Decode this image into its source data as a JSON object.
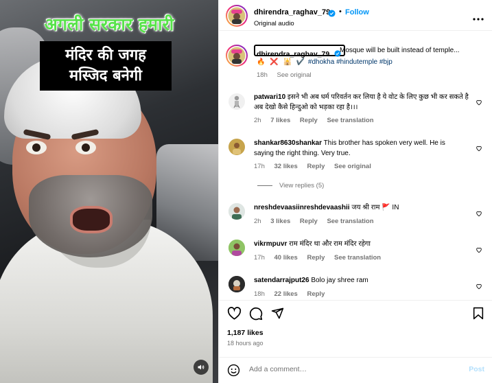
{
  "media": {
    "overlay_top": "अगली सरकार हमारी",
    "overlay_line1": "मंदिर की जगह",
    "overlay_line2": "मस्जिद बनेगी",
    "sound_icon": "speaker-icon"
  },
  "header": {
    "username": "dhirendra_raghav_79",
    "separator": "•",
    "follow_label": "Follow",
    "audio": "Original audio"
  },
  "caption": {
    "username": "dhirendra_raghav_79",
    "text": "Mosque will be built instead of temple...",
    "emojis": "🔥 ❌ 🕌 ✔️",
    "hashtags": "#dhokha #hindutemple #bjp",
    "time": "18h",
    "see_original": "See original"
  },
  "comments": [
    {
      "user": "patwari10",
      "text": "इसने भी अब धर्म परिवर्तन कर लिया है ये वोट के लिए कुछ भी कर सकते है अब देखो कैसे हिन्दुओ को भड़का रहा है।।।",
      "time": "2h",
      "likes": "7 likes",
      "reply": "Reply",
      "action": "See translation"
    },
    {
      "user": "shankar8630shankar",
      "text": "This brother has spoken very well. He is saying the right thing. Very true.",
      "time": "17h",
      "likes": "32 likes",
      "reply": "Reply",
      "action": "See original"
    },
    {
      "user": "nreshdevaasiinreshdevaashii",
      "text": "जय श्री राम 🚩 IN",
      "time": "2h",
      "likes": "3 likes",
      "reply": "Reply",
      "action": "See translation"
    },
    {
      "user": "vikrmpuvr",
      "text": "राम मंदिर था और राम मंदिर रहेगा",
      "time": "17h",
      "likes": "40 likes",
      "reply": "Reply",
      "action": "See translation"
    },
    {
      "user": "satendarrajput26",
      "text": "Bolo jay shree ram",
      "time": "18h",
      "likes": "22 likes",
      "reply": "Reply",
      "action": ""
    }
  ],
  "view_replies": "View replies (5)",
  "stats": {
    "likes": "1,187 likes",
    "ago": "18 hours ago"
  },
  "add_comment": {
    "placeholder": "Add a comment…",
    "post_label": "Post"
  },
  "colors": {
    "accent": "#0095f6",
    "muted": "#737373",
    "hashtag": "#00376b",
    "overlay_green": "#57e24a"
  }
}
